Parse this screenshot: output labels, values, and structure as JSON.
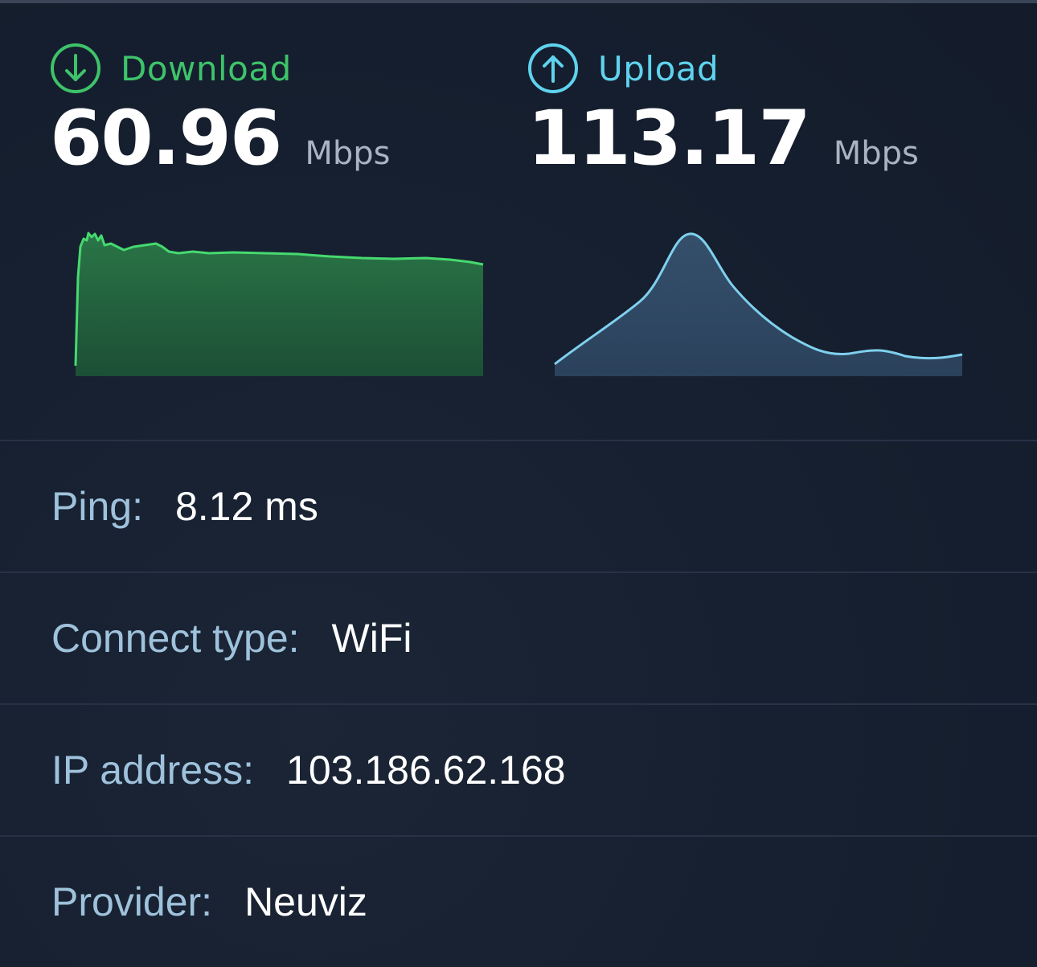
{
  "download": {
    "label": "Download",
    "value": "60.96",
    "unit": "Mbps",
    "icon": "download-arrow-icon",
    "color": "#3ec36a"
  },
  "upload": {
    "label": "Upload",
    "value": "113.17",
    "unit": "Mbps",
    "icon": "upload-arrow-icon",
    "color": "#5fd3ee"
  },
  "info": {
    "ping_label": "Ping:",
    "ping_value": "8.12 ms",
    "connect_label": "Connect type:",
    "connect_value": "WiFi",
    "ip_label": "IP address:",
    "ip_value": "103.186.62.168",
    "provider_label": "Provider:",
    "provider_value": "Neuviz"
  },
  "colors": {
    "background": "#172030",
    "label_text": "#9fc2dc",
    "divider": "#273245"
  }
}
